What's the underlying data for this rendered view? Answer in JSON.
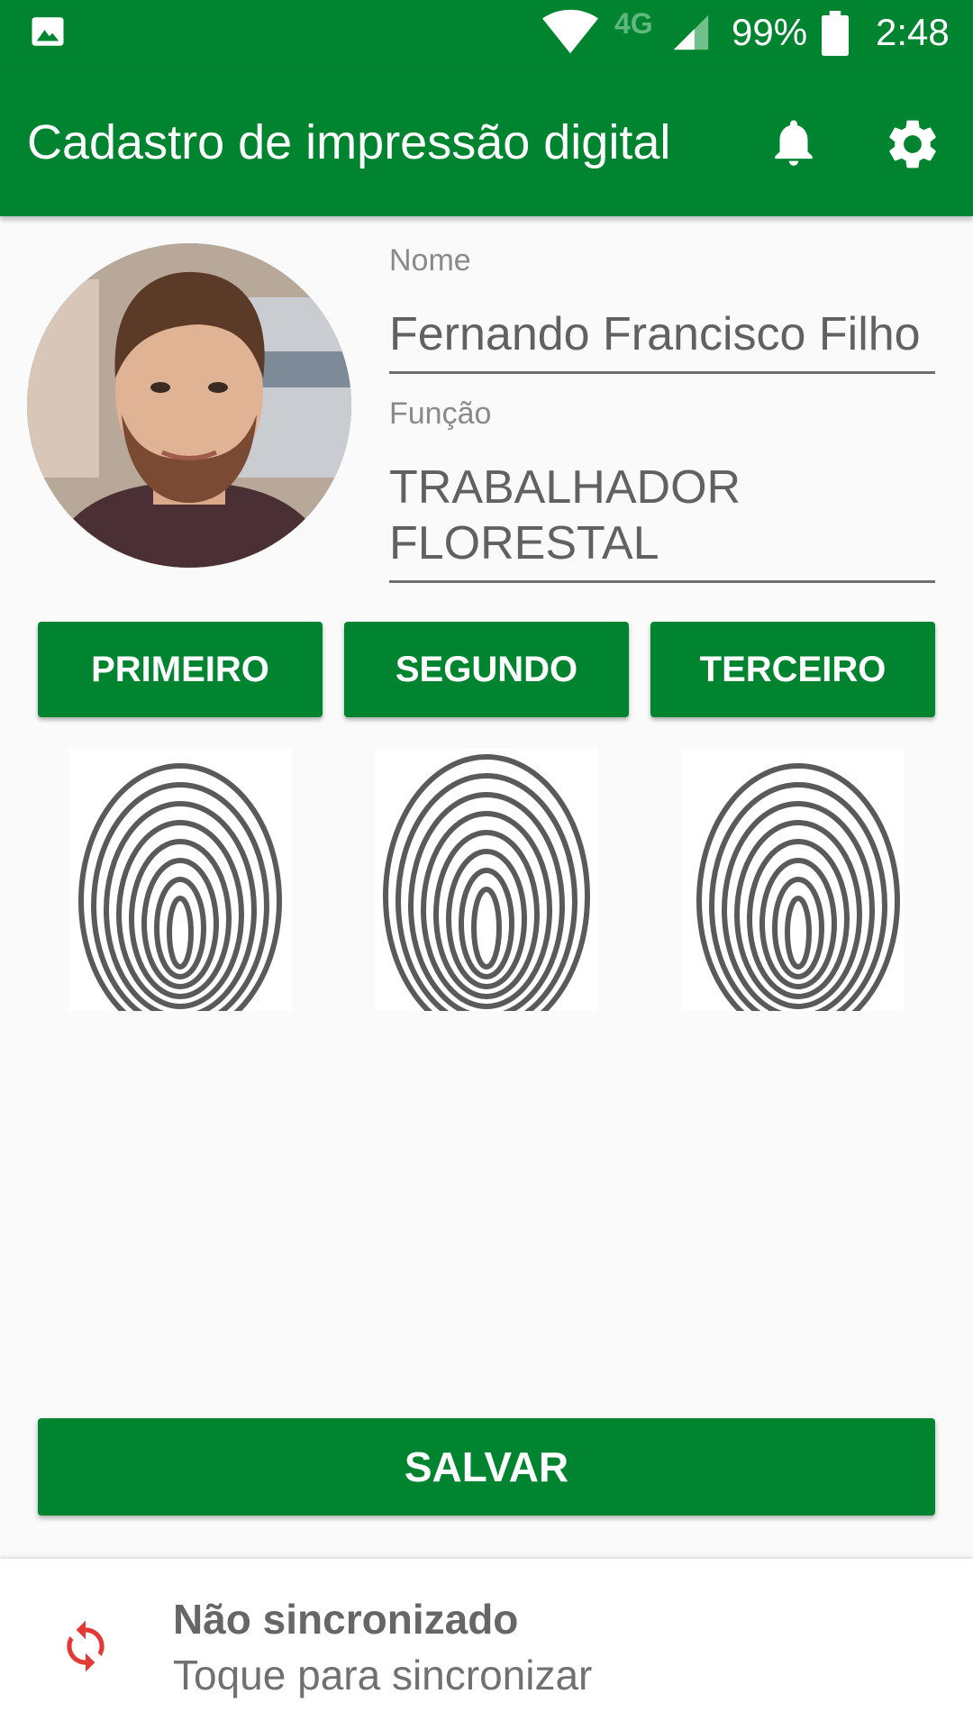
{
  "status_bar": {
    "network": "4G",
    "battery": "99%",
    "time": "2:48",
    "icons": [
      "gallery-icon",
      "wifi-icon",
      "signal-icon",
      "battery-icon"
    ]
  },
  "app_bar": {
    "title": "Cadastro de impressão digital",
    "icons": [
      "bell-icon",
      "gear-icon"
    ]
  },
  "form": {
    "nome_label": "Nome",
    "nome_value": "Fernando Francisco Filho",
    "funcao_label": "Função",
    "funcao_value": "TRABALHADOR FLORESTAL"
  },
  "fingers": {
    "buttons": [
      "PRIMEIRO",
      "SEGUNDO",
      "TERCEIRO"
    ]
  },
  "actions": {
    "save_label": "SALVAR"
  },
  "sync": {
    "title": "Não sincronizado",
    "subtitle": "Toque para sincronizar",
    "icon": "sync-icon"
  },
  "colors": {
    "primary": "#00842f",
    "sync_icon": "#e53935"
  }
}
